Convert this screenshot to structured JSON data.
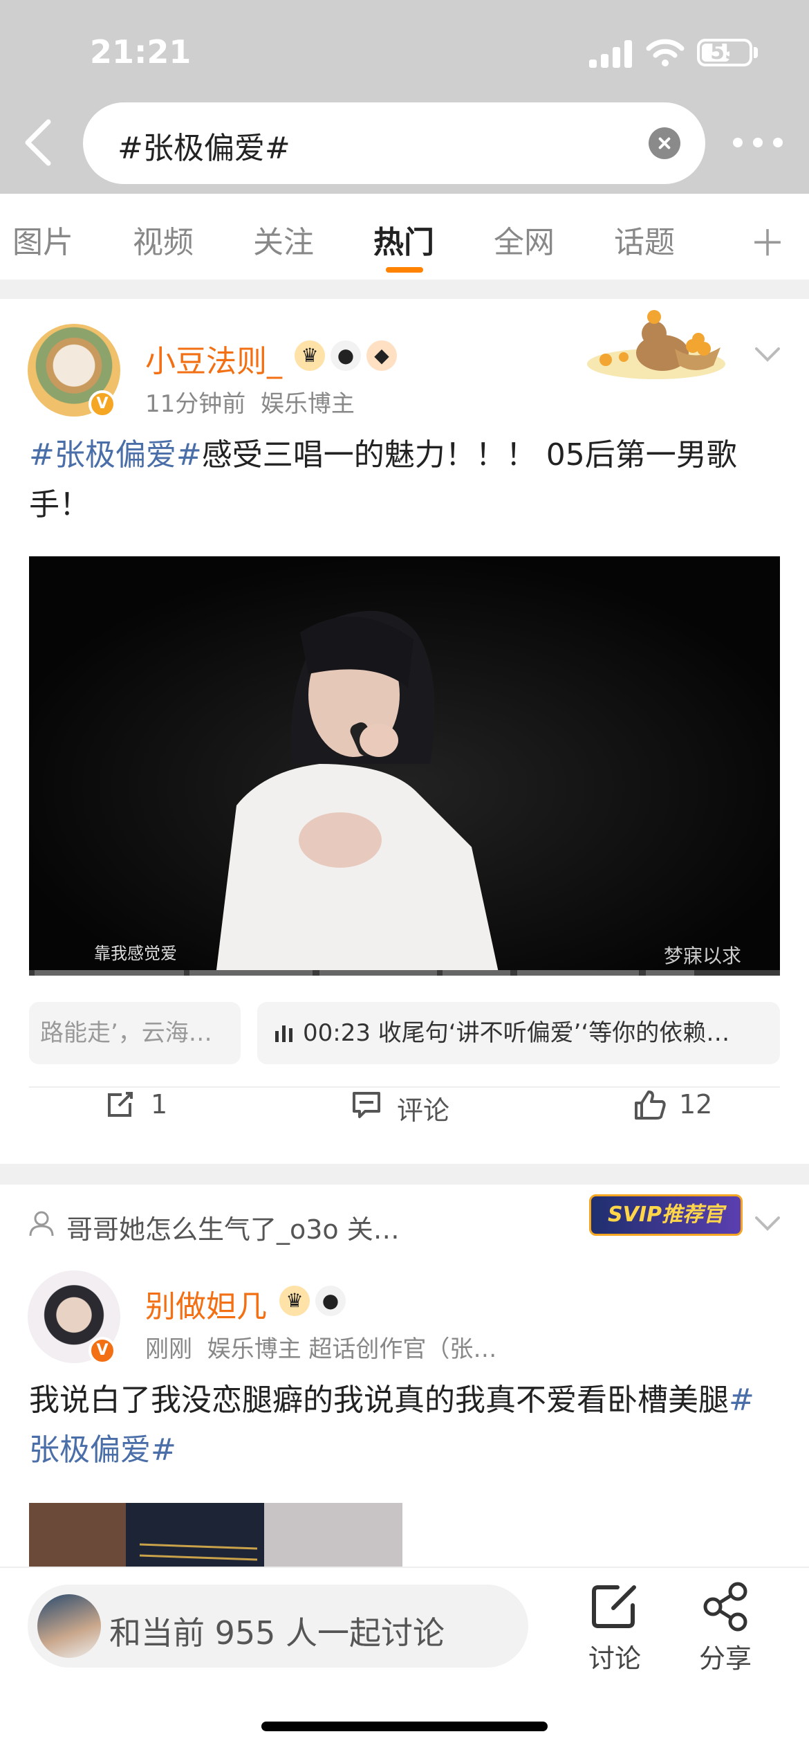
{
  "status_bar": {
    "time": "21:21",
    "battery": "55",
    "battery_level": 0.55
  },
  "search": {
    "query": "#张极偏爱#"
  },
  "tabs": [
    {
      "label": "图片",
      "active": false
    },
    {
      "label": "视频",
      "active": false
    },
    {
      "label": "关注",
      "active": false
    },
    {
      "label": "热门",
      "active": true
    },
    {
      "label": "全网",
      "active": false
    },
    {
      "label": "话题",
      "active": false
    }
  ],
  "post1": {
    "user": "小豆法则_",
    "time": "11分钟前",
    "role": "娱乐博主",
    "tag": "#张极偏爱#",
    "text": "感受三唱一的魅力！！！ 05后第一男歌手！",
    "video_caption": "靠我感觉爱",
    "video_watermark": "梦寐以求",
    "chip_left": "路能走’，云海…",
    "chip_right": "00:23 收尾句‘讲不听偏爱’‘等你的依赖…",
    "repost_count": "1",
    "comment_label": "评论",
    "like_count": "12"
  },
  "post2": {
    "recommend_text": "哥哥她怎么生气了_o3o 关…",
    "svip_badge": "SVIP推荐官",
    "user": "别做妲几",
    "time": "刚刚",
    "role": "娱乐博主 超话创作官（张…",
    "text": "我说白了我没恋腿癖的我说真的我真不爱看卧槽美腿",
    "tag": "#张极偏爱#"
  },
  "bottom_bar": {
    "discuss_prompt": "和当前 955 人一起讨论",
    "discuss_label": "讨论",
    "share_label": "分享"
  },
  "colors": {
    "accent": "#ff8200",
    "username": "#f27013",
    "hashtag": "#4a6ea8",
    "vip_badge": "#f5a623"
  }
}
